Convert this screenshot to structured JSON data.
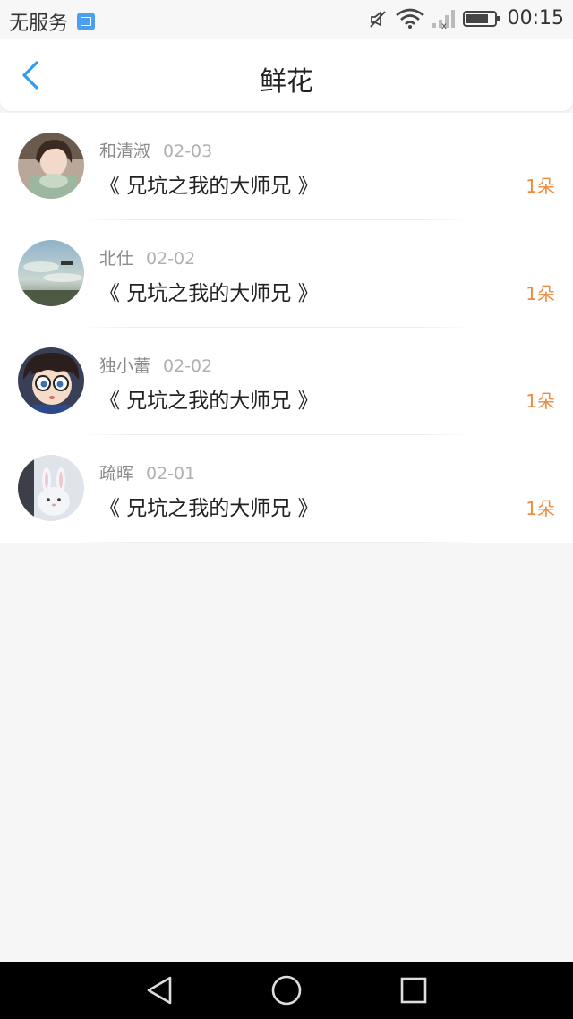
{
  "status_bar": {
    "carrier": "无服务",
    "time": "00:15"
  },
  "header": {
    "title": "鲜花"
  },
  "flowers": [
    {
      "name": "和清淑",
      "date": "02-03",
      "book": "《 兄坑之我的大师兄 》",
      "count": "1朵",
      "avatar": "girl-photo-avatar"
    },
    {
      "name": "北仕",
      "date": "02-02",
      "book": "《 兄坑之我的大师兄 》",
      "count": "1朵",
      "avatar": "sky-photo-avatar"
    },
    {
      "name": "独小蕾",
      "date": "02-02",
      "book": "《 兄坑之我的大师兄 》",
      "count": "1朵",
      "avatar": "anime-boy-avatar"
    },
    {
      "name": "疏晖",
      "date": "02-01",
      "book": "《 兄坑之我的大师兄 》",
      "count": "1朵",
      "avatar": "rabbit-avatar"
    }
  ],
  "colors": {
    "accent": "#2f9cf0",
    "count": "#f08a3c",
    "background": "#f7f6f7"
  },
  "nav": {
    "icons": [
      "back-triangle-icon",
      "home-circle-icon",
      "recents-square-icon"
    ]
  }
}
